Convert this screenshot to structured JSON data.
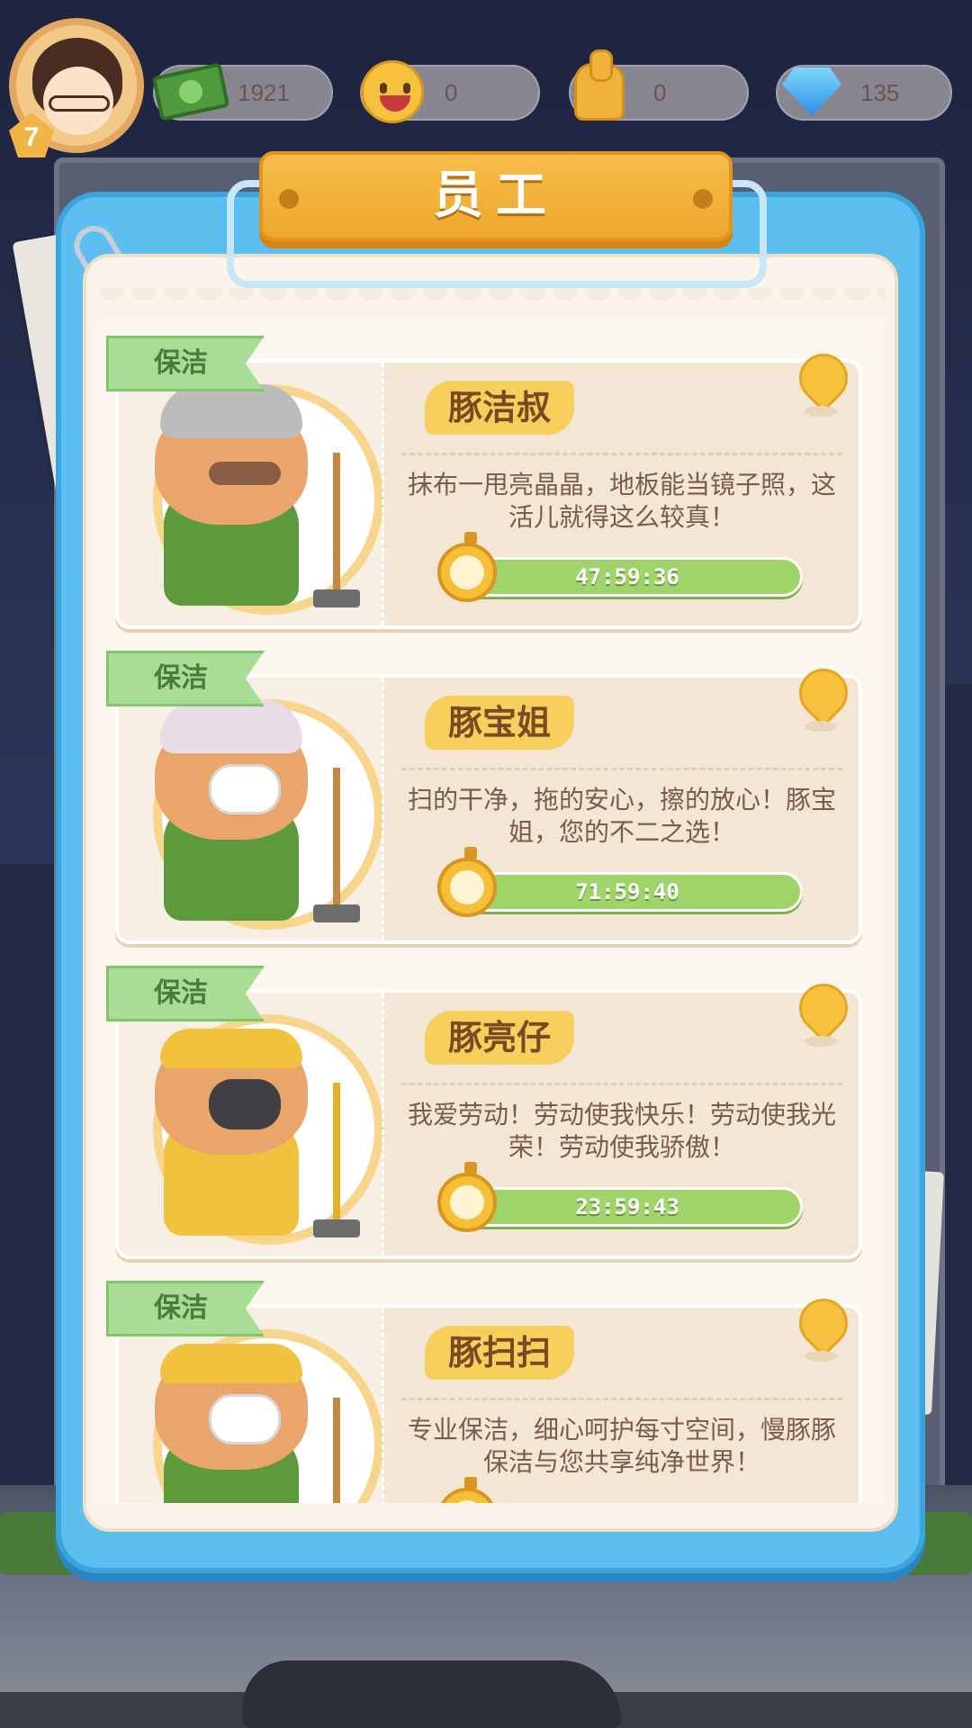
{
  "hud": {
    "level": "7",
    "cash": "1921",
    "smile": "0",
    "likes": "0",
    "gems": "135"
  },
  "panel": {
    "title": "员工"
  },
  "employees": [
    {
      "role": "保洁",
      "name": "豚洁叔",
      "description": "抹布一甩亮晶晶，地板能当镜子照，这活儿就得这么较真！",
      "timer": "47:59:36"
    },
    {
      "role": "保洁",
      "name": "豚宝姐",
      "description": "扫的干净，拖的安心，擦的放心！豚宝姐，您的不二之选！",
      "timer": "71:59:40"
    },
    {
      "role": "保洁",
      "name": "豚亮仔",
      "description": "我爱劳动！劳动使我快乐！劳动使我光荣！劳动使我骄傲！",
      "timer": "23:59:43"
    },
    {
      "role": "保洁",
      "name": "豚扫扫",
      "description": "专业保洁，细心呵护每寸空间，慢豚豚保洁与您共享纯净世界！",
      "timer": ""
    }
  ]
}
